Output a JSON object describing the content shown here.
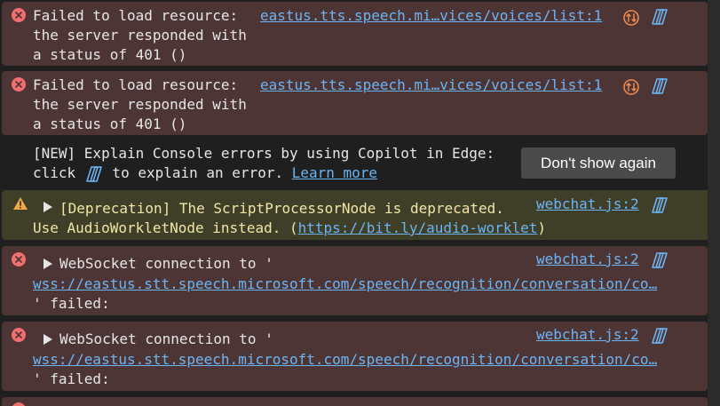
{
  "messages": [
    {
      "type": "error",
      "lines": [
        "Failed to load resource:",
        "the server responded with",
        "a status of 401 ()"
      ],
      "source": "eastus.tts.speech.mi…vices/voices/list:1"
    },
    {
      "type": "error",
      "lines": [
        "Failed to load resource:",
        "the server responded with",
        "a status of 401 ()"
      ],
      "source": "eastus.tts.speech.mi…vices/voices/list:1"
    },
    {
      "type": "info",
      "line1": "[NEW] Explain Console errors by using Copilot in Edge:",
      "line2_before": "click ",
      "line2_after": " to explain an error. ",
      "learn_more": "Learn more",
      "button": "Don't show again"
    },
    {
      "type": "warning",
      "line1": "[Deprecation] The ScriptProcessorNode is deprecated.",
      "line2_before": "Use AudioWorkletNode instead. (",
      "line2_link": "https://bit.ly/audio-worklet",
      "line2_after": ")",
      "source": "webchat.js:2"
    },
    {
      "type": "error",
      "line1": "WebSocket connection to '",
      "url": "wss://eastus.stt.speech.microsoft.com/speech/recognition/conversation/co…",
      "line3": "' failed:",
      "source": "webchat.js:2"
    },
    {
      "type": "error",
      "line1": "WebSocket connection to '",
      "url": "wss://eastus.stt.speech.microsoft.com/speech/recognition/conversation/co…",
      "line3": "' failed:",
      "source": "webchat.js:2"
    }
  ],
  "colors": {
    "error_bg": "#4e3535",
    "warning_bg": "#3f3e29",
    "link": "#6cb5f5",
    "error_icon": "#f26f6f",
    "warning_icon": "#f0a84a",
    "network_icon": "#f08a4b"
  }
}
